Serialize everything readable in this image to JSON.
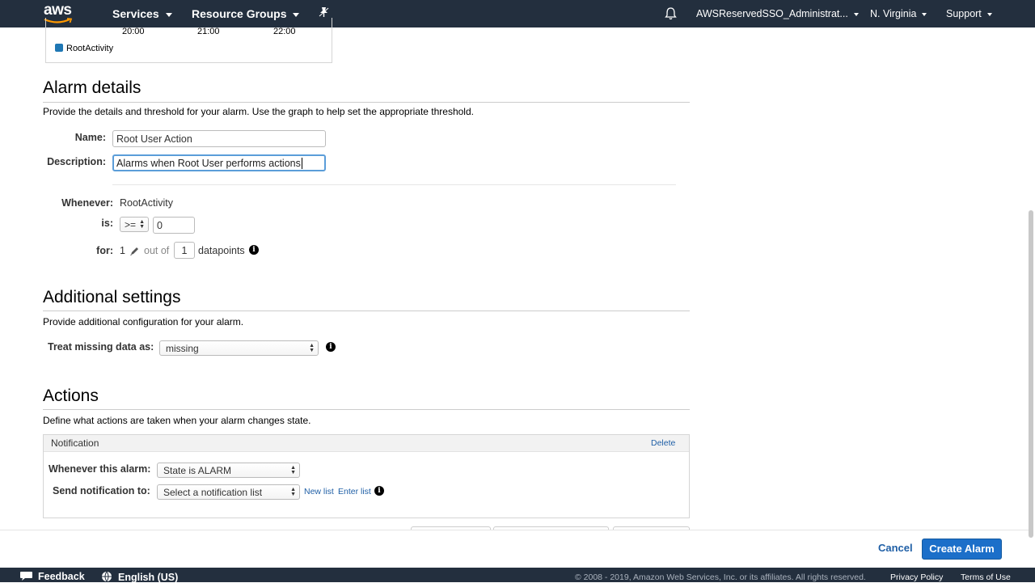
{
  "topnav": {
    "logo": "aws",
    "services": "Services",
    "resource_groups": "Resource Groups",
    "account": "AWSReservedSSO_Administrat...",
    "region": "N. Virginia",
    "support": "Support"
  },
  "chart": {
    "ticks": [
      "20:00",
      "21:00",
      "22:00"
    ],
    "legend": "RootActivity",
    "series_color": "#1f77b4"
  },
  "alarm_details": {
    "title": "Alarm details",
    "description": "Provide the details and threshold for your alarm. Use the graph to help set the appropriate threshold.",
    "name_label": "Name:",
    "name_value": "Root User Action",
    "description_label": "Description:",
    "description_value": "Alarms when Root User performs actions",
    "whenever_label": "Whenever:",
    "whenever_value": "RootActivity",
    "is_label": "is:",
    "operator": ">=",
    "threshold": "0",
    "for_label": "for:",
    "for_value": "1",
    "out_of": "out of",
    "datapoints_value": "1",
    "datapoints_label": "datapoints"
  },
  "additional_settings": {
    "title": "Additional settings",
    "description": "Provide additional configuration for your alarm.",
    "missing_label": "Treat missing data as:",
    "missing_value": "missing"
  },
  "actions": {
    "title": "Actions",
    "description": "Define what actions are taken when your alarm changes state.",
    "panel_title": "Notification",
    "delete": "Delete",
    "whenever_label": "Whenever this alarm:",
    "state_value": "State is ALARM",
    "send_label": "Send notification to:",
    "send_value": "Select a notification list",
    "new_list": "New list",
    "enter_list": "Enter list"
  },
  "buttons": {
    "cancel": "Cancel",
    "create": "Create Alarm"
  },
  "footer": {
    "feedback": "Feedback",
    "language": "English (US)",
    "copyright": "© 2008 - 2019, Amazon Web Services, Inc. or its affiliates. All rights reserved.",
    "privacy": "Privacy Policy",
    "terms": "Terms of Use"
  },
  "colors": {
    "nav_bg": "#232f3e",
    "primary_button": "#1c6fc9",
    "link": "#1f5fa6"
  }
}
